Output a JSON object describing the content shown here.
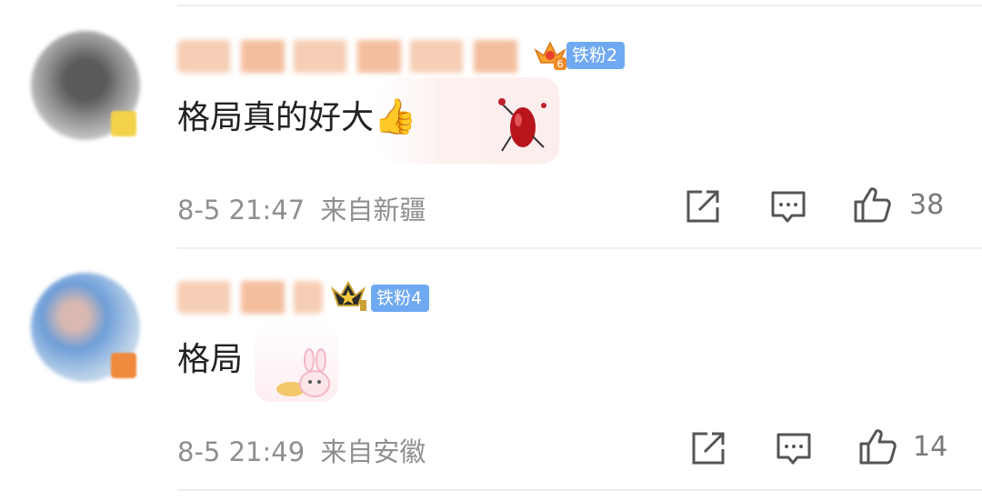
{
  "comments": [
    {
      "fan_badge": "铁粉2",
      "text": "格局真的好大",
      "emoji": "👍",
      "timestamp": "8-5 21:47",
      "location": "来自新疆",
      "likes": "38",
      "level_icon": "crown-6-icon"
    },
    {
      "fan_badge": "铁粉4",
      "text": "格局",
      "timestamp": "8-5 21:49",
      "location": "来自安徽",
      "likes": "14",
      "level_icon": "crown-star-1-icon"
    }
  ],
  "icons": {
    "share": "share-icon",
    "reply": "comment-icon",
    "like": "thumbs-up-icon"
  },
  "colors": {
    "fan_badge": "#6fa9f2",
    "meta_text": "#8f8f8f",
    "divider": "#eeeeee"
  }
}
